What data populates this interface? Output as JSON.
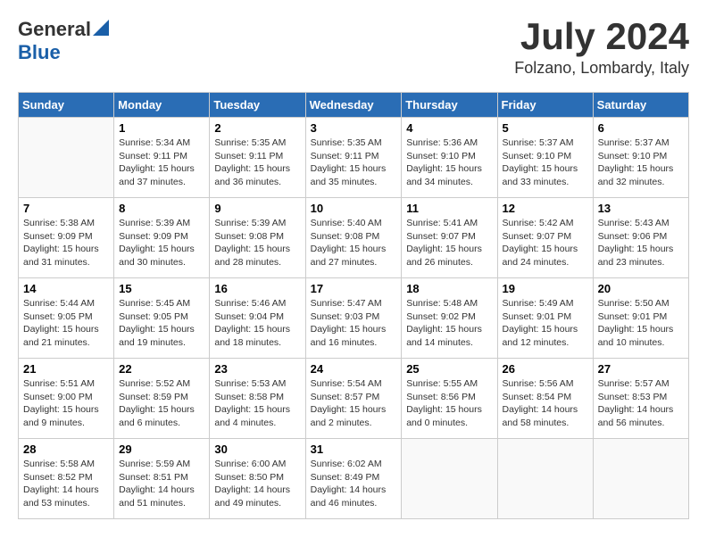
{
  "header": {
    "logo_general": "General",
    "logo_blue": "Blue",
    "month": "July 2024",
    "location": "Folzano, Lombardy, Italy"
  },
  "days_of_week": [
    "Sunday",
    "Monday",
    "Tuesday",
    "Wednesday",
    "Thursday",
    "Friday",
    "Saturday"
  ],
  "weeks": [
    [
      {
        "day": "",
        "info": ""
      },
      {
        "day": "1",
        "info": "Sunrise: 5:34 AM\nSunset: 9:11 PM\nDaylight: 15 hours\nand 37 minutes."
      },
      {
        "day": "2",
        "info": "Sunrise: 5:35 AM\nSunset: 9:11 PM\nDaylight: 15 hours\nand 36 minutes."
      },
      {
        "day": "3",
        "info": "Sunrise: 5:35 AM\nSunset: 9:11 PM\nDaylight: 15 hours\nand 35 minutes."
      },
      {
        "day": "4",
        "info": "Sunrise: 5:36 AM\nSunset: 9:10 PM\nDaylight: 15 hours\nand 34 minutes."
      },
      {
        "day": "5",
        "info": "Sunrise: 5:37 AM\nSunset: 9:10 PM\nDaylight: 15 hours\nand 33 minutes."
      },
      {
        "day": "6",
        "info": "Sunrise: 5:37 AM\nSunset: 9:10 PM\nDaylight: 15 hours\nand 32 minutes."
      }
    ],
    [
      {
        "day": "7",
        "info": "Sunrise: 5:38 AM\nSunset: 9:09 PM\nDaylight: 15 hours\nand 31 minutes."
      },
      {
        "day": "8",
        "info": "Sunrise: 5:39 AM\nSunset: 9:09 PM\nDaylight: 15 hours\nand 30 minutes."
      },
      {
        "day": "9",
        "info": "Sunrise: 5:39 AM\nSunset: 9:08 PM\nDaylight: 15 hours\nand 28 minutes."
      },
      {
        "day": "10",
        "info": "Sunrise: 5:40 AM\nSunset: 9:08 PM\nDaylight: 15 hours\nand 27 minutes."
      },
      {
        "day": "11",
        "info": "Sunrise: 5:41 AM\nSunset: 9:07 PM\nDaylight: 15 hours\nand 26 minutes."
      },
      {
        "day": "12",
        "info": "Sunrise: 5:42 AM\nSunset: 9:07 PM\nDaylight: 15 hours\nand 24 minutes."
      },
      {
        "day": "13",
        "info": "Sunrise: 5:43 AM\nSunset: 9:06 PM\nDaylight: 15 hours\nand 23 minutes."
      }
    ],
    [
      {
        "day": "14",
        "info": "Sunrise: 5:44 AM\nSunset: 9:05 PM\nDaylight: 15 hours\nand 21 minutes."
      },
      {
        "day": "15",
        "info": "Sunrise: 5:45 AM\nSunset: 9:05 PM\nDaylight: 15 hours\nand 19 minutes."
      },
      {
        "day": "16",
        "info": "Sunrise: 5:46 AM\nSunset: 9:04 PM\nDaylight: 15 hours\nand 18 minutes."
      },
      {
        "day": "17",
        "info": "Sunrise: 5:47 AM\nSunset: 9:03 PM\nDaylight: 15 hours\nand 16 minutes."
      },
      {
        "day": "18",
        "info": "Sunrise: 5:48 AM\nSunset: 9:02 PM\nDaylight: 15 hours\nand 14 minutes."
      },
      {
        "day": "19",
        "info": "Sunrise: 5:49 AM\nSunset: 9:01 PM\nDaylight: 15 hours\nand 12 minutes."
      },
      {
        "day": "20",
        "info": "Sunrise: 5:50 AM\nSunset: 9:01 PM\nDaylight: 15 hours\nand 10 minutes."
      }
    ],
    [
      {
        "day": "21",
        "info": "Sunrise: 5:51 AM\nSunset: 9:00 PM\nDaylight: 15 hours\nand 9 minutes."
      },
      {
        "day": "22",
        "info": "Sunrise: 5:52 AM\nSunset: 8:59 PM\nDaylight: 15 hours\nand 6 minutes."
      },
      {
        "day": "23",
        "info": "Sunrise: 5:53 AM\nSunset: 8:58 PM\nDaylight: 15 hours\nand 4 minutes."
      },
      {
        "day": "24",
        "info": "Sunrise: 5:54 AM\nSunset: 8:57 PM\nDaylight: 15 hours\nand 2 minutes."
      },
      {
        "day": "25",
        "info": "Sunrise: 5:55 AM\nSunset: 8:56 PM\nDaylight: 15 hours\nand 0 minutes."
      },
      {
        "day": "26",
        "info": "Sunrise: 5:56 AM\nSunset: 8:54 PM\nDaylight: 14 hours\nand 58 minutes."
      },
      {
        "day": "27",
        "info": "Sunrise: 5:57 AM\nSunset: 8:53 PM\nDaylight: 14 hours\nand 56 minutes."
      }
    ],
    [
      {
        "day": "28",
        "info": "Sunrise: 5:58 AM\nSunset: 8:52 PM\nDaylight: 14 hours\nand 53 minutes."
      },
      {
        "day": "29",
        "info": "Sunrise: 5:59 AM\nSunset: 8:51 PM\nDaylight: 14 hours\nand 51 minutes."
      },
      {
        "day": "30",
        "info": "Sunrise: 6:00 AM\nSunset: 8:50 PM\nDaylight: 14 hours\nand 49 minutes."
      },
      {
        "day": "31",
        "info": "Sunrise: 6:02 AM\nSunset: 8:49 PM\nDaylight: 14 hours\nand 46 minutes."
      },
      {
        "day": "",
        "info": ""
      },
      {
        "day": "",
        "info": ""
      },
      {
        "day": "",
        "info": ""
      }
    ]
  ]
}
